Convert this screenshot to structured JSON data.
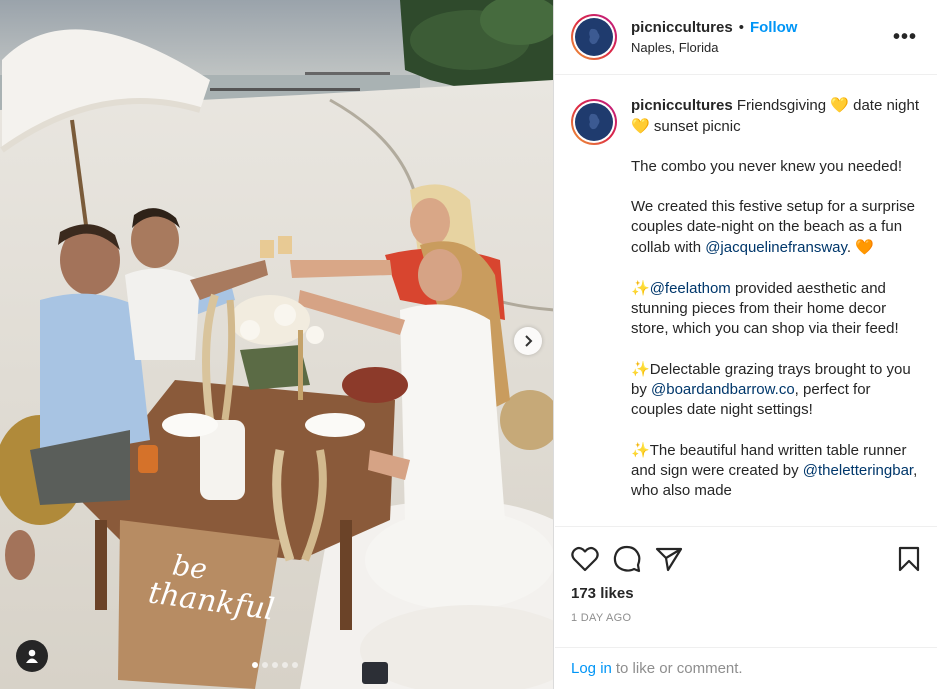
{
  "post": {
    "username": "picniccultures",
    "bullet": "•",
    "follow_label": "Follow",
    "location": "Naples, Florida",
    "more_label": "•••",
    "carousel_dots": 5,
    "active_dot": 0
  },
  "caption": {
    "username": "picniccultures",
    "line1_a": " Friendsgiving ",
    "line1_b": " date night ",
    "line1_c": " sunset picnic",
    "heart_yellow": "💛",
    "heart_orange": "🧡",
    "sparkle": "✨",
    "p2": "The combo you never knew you needed!",
    "p3_a": "We created this festive setup for a surprise couples date-night on the beach as a fun collab with ",
    "p3_mention": "@jacquelinefransway",
    "p3_b": ". ",
    "p4_mention": "@feelathom",
    "p4_b": " provided aesthetic and stunning pieces from their home decor store, which you can shop via their feed!",
    "p5_a": "Delectable grazing trays brought to you by ",
    "p5_mention": "@boardandbarrow.co",
    "p5_b": ",  perfect for couples date night settings!",
    "p6_a": "The beautiful hand written table runner and sign were created by ",
    "p6_mention": "@theletteringbar",
    "p6_b": ", who also made"
  },
  "engagement": {
    "likes": "173 likes",
    "timestamp": "1 DAY AGO"
  },
  "login": {
    "link": "Log in",
    "rest": "to like or comment."
  },
  "runner_text": {
    "word1": "be",
    "word2": "thankful"
  }
}
